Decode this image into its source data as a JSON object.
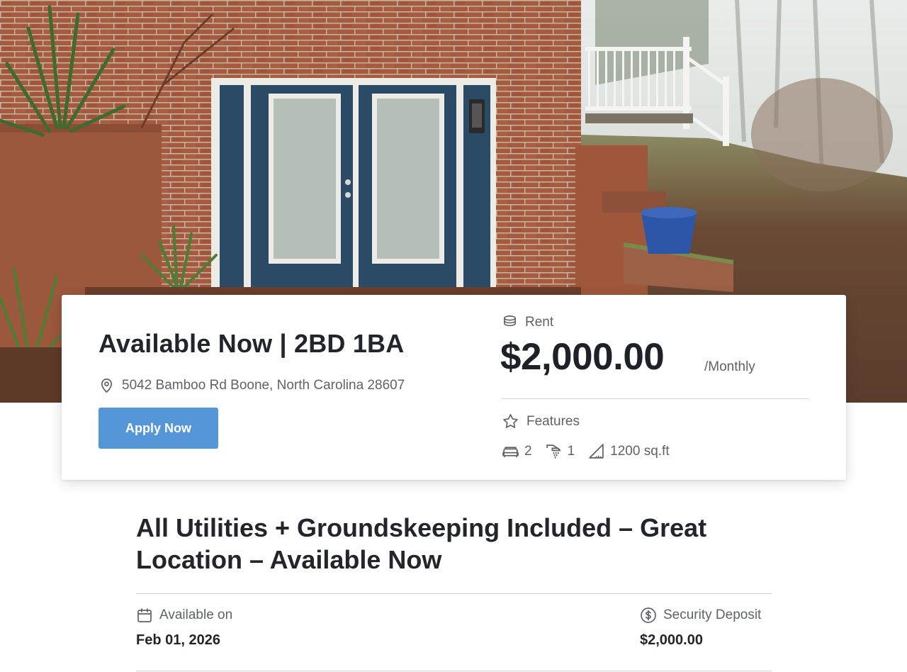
{
  "listing": {
    "title": "Available Now | 2BD 1BA",
    "address": "5042 Bamboo Rd Boone, North Carolina 28607",
    "apply_label": "Apply Now",
    "rent_label": "Rent",
    "rent_price": "$2,000.00",
    "rent_period": "/Monthly",
    "features_label": "Features",
    "features": {
      "bedrooms": "2",
      "bathrooms": "1",
      "area": "1200 sq.ft"
    }
  },
  "description": {
    "headline": "All Utilities + Groundskeeping Included – Great Location – Available Now"
  },
  "details": {
    "available_label": "Available on",
    "available_value": "Feb 01, 2026",
    "deposit_label": "Security Deposit",
    "deposit_value": "$2,000.00"
  },
  "colors": {
    "accent": "#5596d9",
    "text": "#23252c",
    "muted": "#5f626b"
  },
  "icons": {
    "address": "map-pin-icon",
    "rent": "coins-icon",
    "features": "star-icon",
    "bed": "bed-icon",
    "bath": "shower-icon",
    "area": "ruler-triangle-icon",
    "available": "calendar-icon",
    "deposit": "dollar-circle-icon"
  }
}
